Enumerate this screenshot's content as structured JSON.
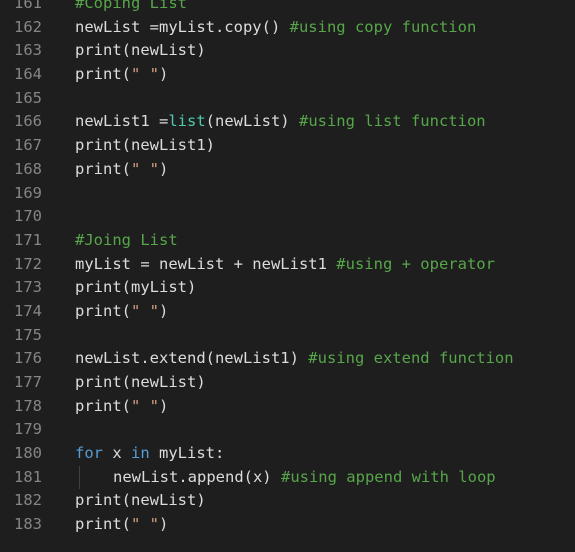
{
  "editor": {
    "lines": [
      {
        "number": "161",
        "tokens": [
          {
            "t": "comment",
            "v": "#Coping List"
          }
        ]
      },
      {
        "number": "162",
        "tokens": [
          {
            "t": "plain",
            "v": "newList =myList.copy() "
          },
          {
            "t": "comment",
            "v": "#using copy function"
          }
        ]
      },
      {
        "number": "163",
        "tokens": [
          {
            "t": "plain",
            "v": "print(newList)"
          }
        ]
      },
      {
        "number": "164",
        "tokens": [
          {
            "t": "plain",
            "v": "print("
          },
          {
            "t": "string",
            "v": "\" \""
          },
          {
            "t": "plain",
            "v": ")"
          }
        ]
      },
      {
        "number": "165",
        "tokens": []
      },
      {
        "number": "166",
        "tokens": [
          {
            "t": "plain",
            "v": "newList1 ="
          },
          {
            "t": "builtin",
            "v": "list"
          },
          {
            "t": "plain",
            "v": "(newList) "
          },
          {
            "t": "comment",
            "v": "#using list function"
          }
        ]
      },
      {
        "number": "167",
        "tokens": [
          {
            "t": "plain",
            "v": "print(newList1)"
          }
        ]
      },
      {
        "number": "168",
        "tokens": [
          {
            "t": "plain",
            "v": "print("
          },
          {
            "t": "string",
            "v": "\" \""
          },
          {
            "t": "plain",
            "v": ")"
          }
        ]
      },
      {
        "number": "169",
        "tokens": []
      },
      {
        "number": "170",
        "tokens": []
      },
      {
        "number": "171",
        "tokens": [
          {
            "t": "comment",
            "v": "#Joing List"
          }
        ]
      },
      {
        "number": "172",
        "tokens": [
          {
            "t": "plain",
            "v": "myList = newList + newList1 "
          },
          {
            "t": "comment",
            "v": "#using + operator"
          }
        ]
      },
      {
        "number": "173",
        "tokens": [
          {
            "t": "plain",
            "v": "print(myList)"
          }
        ]
      },
      {
        "number": "174",
        "tokens": [
          {
            "t": "plain",
            "v": "print("
          },
          {
            "t": "string",
            "v": "\" \""
          },
          {
            "t": "plain",
            "v": ")"
          }
        ]
      },
      {
        "number": "175",
        "tokens": []
      },
      {
        "number": "176",
        "tokens": [
          {
            "t": "plain",
            "v": "newList.extend(newList1) "
          },
          {
            "t": "comment",
            "v": "#using extend function"
          }
        ]
      },
      {
        "number": "177",
        "tokens": [
          {
            "t": "plain",
            "v": "print(newList)"
          }
        ]
      },
      {
        "number": "178",
        "tokens": [
          {
            "t": "plain",
            "v": "print("
          },
          {
            "t": "string",
            "v": "\" \""
          },
          {
            "t": "plain",
            "v": ")"
          }
        ]
      },
      {
        "number": "179",
        "tokens": []
      },
      {
        "number": "180",
        "tokens": [
          {
            "t": "keyword",
            "v": "for"
          },
          {
            "t": "plain",
            "v": " x "
          },
          {
            "t": "keyword",
            "v": "in"
          },
          {
            "t": "plain",
            "v": " myList:"
          }
        ]
      },
      {
        "number": "181",
        "indent": true,
        "tokens": [
          {
            "t": "plain",
            "v": "newList.append(x) "
          },
          {
            "t": "comment",
            "v": "#using append with loop"
          }
        ]
      },
      {
        "number": "182",
        "tokens": [
          {
            "t": "plain",
            "v": "print(newList)"
          }
        ]
      },
      {
        "number": "183",
        "tokens": [
          {
            "t": "plain",
            "v": "print("
          },
          {
            "t": "string",
            "v": "\" \""
          },
          {
            "t": "plain",
            "v": ")"
          }
        ]
      }
    ]
  },
  "colors": {
    "background": "#1e1e1e",
    "line_number": "#858585",
    "plain": "#dcdcdc",
    "comment": "#57a64a",
    "keyword": "#569cd6",
    "builtin": "#4ec9b0",
    "string": "#d69d85"
  }
}
